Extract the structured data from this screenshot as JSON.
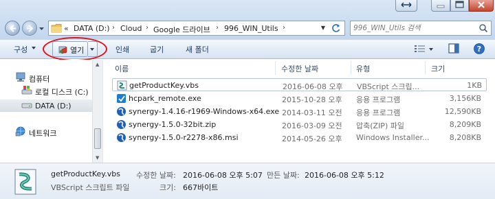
{
  "address": {
    "chevron": "«",
    "crumbs": [
      "DATA (D:)",
      "Cloud",
      "Google 드라이브",
      "996_WIN_Utils"
    ],
    "search_placeholder": "996_WIN_Utils 검색"
  },
  "toolbar": {
    "organize": "구성",
    "open": "열기",
    "print": "인쇄",
    "burn": "굽기",
    "new_folder": "새 폴더"
  },
  "nav": {
    "computer": "컴퓨터",
    "local_disk": "로컬 디스크 (C:)",
    "data_drive": "DATA (D:)",
    "network": "네트워크"
  },
  "columns": {
    "name": "이름",
    "date": "수정한 날짜",
    "type": "유형",
    "size": "크기"
  },
  "files": [
    {
      "name": "getProductKey.vbs",
      "date": "2016-06-08 오후 ...",
      "type": "VBScript 스크립...",
      "size": "1KB",
      "icon": "vbs-script-icon"
    },
    {
      "name": "hcpark_remote.exe",
      "date": "2015-10-28 오후 ...",
      "type": "응용 프로그램",
      "size": "3,156KB",
      "icon": "exe-icon"
    },
    {
      "name": "synergy-1.4.16-r1969-Windows-x64.exe",
      "date": "2014-03-11 오전 ...",
      "type": "응용 프로그램",
      "size": "12,590KB",
      "icon": "synergy-icon"
    },
    {
      "name": "synergy-1.5.0-32bit.zip",
      "date": "2016-03-09 오전 ...",
      "type": "압축(ZIP) 파일",
      "size": "8,209KB",
      "icon": "synergy-icon"
    },
    {
      "name": "synergy-1.5.0-r2278-x86.msi",
      "date": "2014-05-26 오후 ...",
      "type": "Windows Installer...",
      "size": "8,208KB",
      "icon": "synergy-icon"
    }
  ],
  "details": {
    "file_name": "getProductKey.vbs",
    "file_type": "VBScript 스크립트 파일",
    "modified_label": "수정한 날짜:",
    "modified_value": "2016-06-08 오후 5:07",
    "created_label": "만든 날짜:",
    "created_value": "2016-06-08 오후 5:12",
    "size_label": "크기:",
    "size_value": "667바이트"
  },
  "colors": {
    "annotation": "#e2101a",
    "toolbar_text": "#1e395b"
  }
}
